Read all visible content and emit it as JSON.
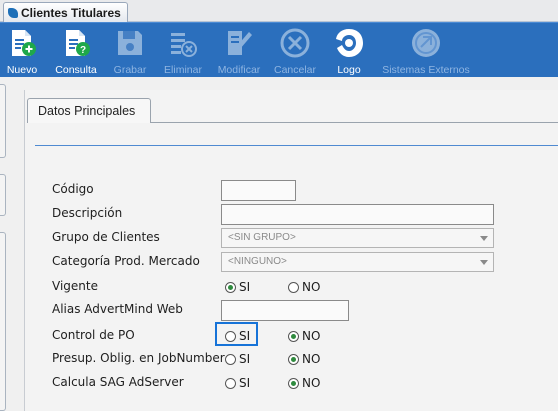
{
  "window_tab": {
    "title": "Clientes Titulares"
  },
  "toolbar": {
    "buttons": [
      {
        "id": "nuevo",
        "label": "Nuevo",
        "icon": "new-document-icon",
        "enabled": true
      },
      {
        "id": "consulta",
        "label": "Consulta",
        "icon": "query-document-icon",
        "enabled": true
      },
      {
        "id": "grabar",
        "label": "Grabar",
        "icon": "save-disk-icon",
        "enabled": false
      },
      {
        "id": "eliminar",
        "label": "Eliminar",
        "icon": "delete-list-icon",
        "enabled": false
      },
      {
        "id": "modificar",
        "label": "Modificar",
        "icon": "edit-pencil-icon",
        "enabled": false
      },
      {
        "id": "cancelar",
        "label": "Cancelar",
        "icon": "cancel-x-icon",
        "enabled": false
      },
      {
        "id": "logo",
        "label": "Logo",
        "icon": "logo-icon",
        "enabled": true
      },
      {
        "id": "sistemas_externos",
        "label": "Sistemas Externos",
        "icon": "external-systems-icon",
        "enabled": false
      }
    ],
    "colors": {
      "background": "#2b6fbd",
      "label": "#ffffff",
      "label_disabled": "#8fb5e2",
      "icon_accent": "#1fa84a"
    }
  },
  "section": {
    "tab_label": "Datos Principales"
  },
  "form": {
    "codigo": {
      "label": "Código",
      "value": ""
    },
    "descripcion": {
      "label": "Descripción",
      "value": ""
    },
    "grupo_clientes": {
      "label": "Grupo de Clientes",
      "selected": "<SIN GRUPO>"
    },
    "categoria": {
      "label": "Categoría Prod. Mercado",
      "selected": "<NINGUNO>"
    },
    "vigente": {
      "label": "Vigente",
      "yes_label": "SI",
      "no_label": "NO",
      "selected": "SI"
    },
    "alias": {
      "label": "Alias AdvertMind Web",
      "value": ""
    },
    "control_po": {
      "label": "Control de PO",
      "yes_label": "SI",
      "no_label": "NO",
      "selected": "NO"
    },
    "presup": {
      "label": "Presup. Oblig. en JobNumber",
      "yes_label": "SI",
      "no_label": "NO",
      "selected": "NO"
    },
    "sag": {
      "label": "Calcula SAG AdServer",
      "yes_label": "SI",
      "no_label": "NO",
      "selected": "NO"
    }
  }
}
